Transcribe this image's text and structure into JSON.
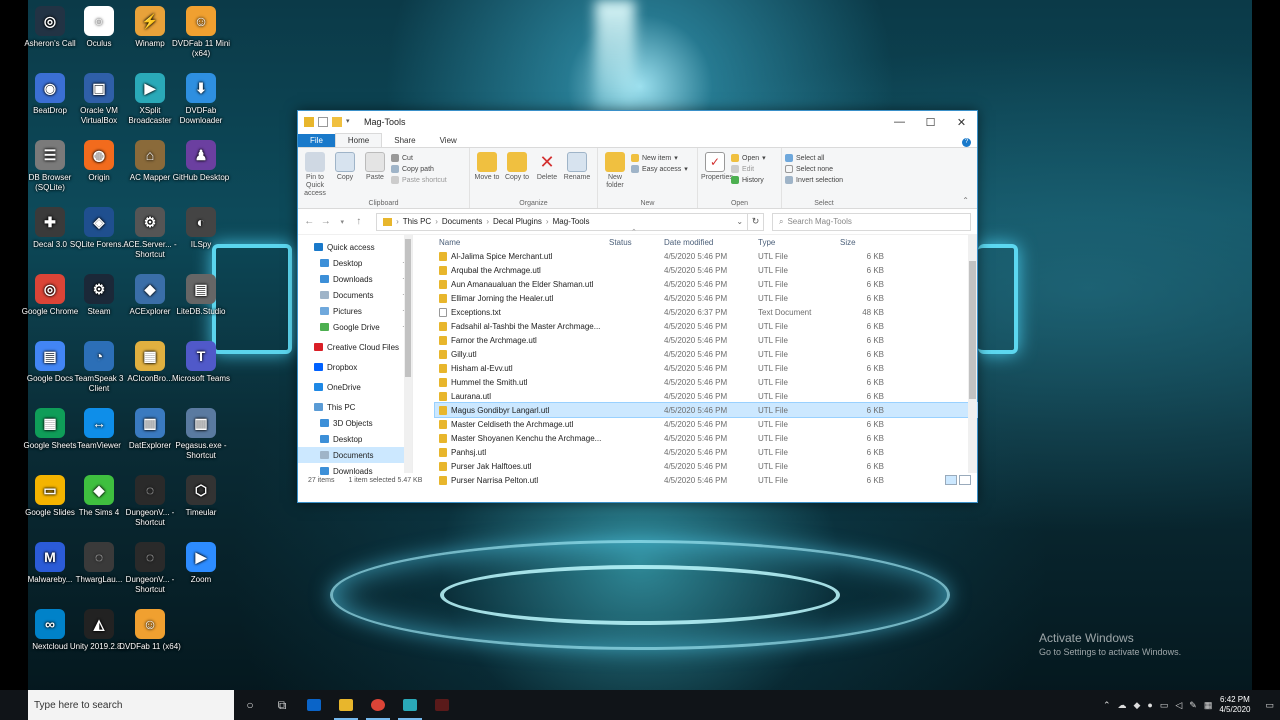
{
  "desktop_icons": [
    {
      "label": "Asheron's Call",
      "color": "#223344",
      "glyph": "◎"
    },
    {
      "label": "Oculus",
      "color": "#ffffff",
      "glyph": "○"
    },
    {
      "label": "Winamp",
      "color": "#e8a23a",
      "glyph": "⚡"
    },
    {
      "label": "DVDFab 11 Mini (x64)",
      "color": "#f0a030",
      "glyph": "☺"
    },
    {
      "label": "BeatDrop",
      "color": "#3b6fd4",
      "glyph": "◉"
    },
    {
      "label": "Oracle VM VirtualBox",
      "color": "#2f5fa8",
      "glyph": "▣"
    },
    {
      "label": "XSplit Broadcaster",
      "color": "#2aa9b8",
      "glyph": "▶"
    },
    {
      "label": "DVDFab Downloader",
      "color": "#2e8fe0",
      "glyph": "⬇"
    },
    {
      "label": "DB Browser (SQLite)",
      "color": "#7a7a7a",
      "glyph": "☰"
    },
    {
      "label": "Origin",
      "color": "#f26b1d",
      "glyph": "◍"
    },
    {
      "label": "AC Mapper",
      "color": "#8a6a3a",
      "glyph": "⌂"
    },
    {
      "label": "GitHub Desktop",
      "color": "#6b3fa0",
      "glyph": "♟"
    },
    {
      "label": "Decal 3.0",
      "color": "#3a3a3a",
      "glyph": "✚"
    },
    {
      "label": "SQLite Forens...",
      "color": "#1f4f8f",
      "glyph": "◈"
    },
    {
      "label": "ACE.Server... - Shortcut",
      "color": "#555555",
      "glyph": "⚙"
    },
    {
      "label": "ILSpy",
      "color": "#444444",
      "glyph": "◐"
    },
    {
      "label": "Google Chrome",
      "color": "#db4437",
      "glyph": "◎"
    },
    {
      "label": "Steam",
      "color": "#1b2838",
      "glyph": "⚙"
    },
    {
      "label": "ACExplorer",
      "color": "#3a6ea8",
      "glyph": "◆"
    },
    {
      "label": "LiteDB.Studio",
      "color": "#666666",
      "glyph": "▤"
    },
    {
      "label": "Google Docs",
      "color": "#4285f4",
      "glyph": "▤"
    },
    {
      "label": "TeamSpeak 3 Client",
      "color": "#2c6fb7",
      "glyph": "◔"
    },
    {
      "label": "ACIconBro...",
      "color": "#e0b040",
      "glyph": "▦"
    },
    {
      "label": "Microsoft Teams",
      "color": "#5059c9",
      "glyph": "T"
    },
    {
      "label": "Google Sheets",
      "color": "#0f9d58",
      "glyph": "▦"
    },
    {
      "label": "TeamViewer",
      "color": "#0e8ee9",
      "glyph": "↔"
    },
    {
      "label": "DatExplorer",
      "color": "#3a7ac0",
      "glyph": "▥"
    },
    {
      "label": "Pegasus.exe - Shortcut",
      "color": "#5a7aa0",
      "glyph": "▥"
    },
    {
      "label": "Google Slides",
      "color": "#f4b400",
      "glyph": "▭"
    },
    {
      "label": "The Sims 4",
      "color": "#3fbf3f",
      "glyph": "◆"
    },
    {
      "label": "DungeonV... - Shortcut",
      "color": "#2a2a2a",
      "glyph": "◌"
    },
    {
      "label": "Timeular",
      "color": "#333333",
      "glyph": "⬡"
    },
    {
      "label": "Malwareby...",
      "color": "#2b5bd7",
      "glyph": "M"
    },
    {
      "label": "ThwargLau...",
      "color": "#3a3a3a",
      "glyph": "◌"
    },
    {
      "label": "DungeonV... - Shortcut",
      "color": "#2a2a2a",
      "glyph": "◌"
    },
    {
      "label": "Zoom",
      "color": "#2d8cff",
      "glyph": "▶"
    },
    {
      "label": "Nextcloud",
      "color": "#0082c9",
      "glyph": "∞"
    },
    {
      "label": "Unity 2019.2.8...",
      "color": "#222222",
      "glyph": "◭"
    },
    {
      "label": "DVDFab 11 (x64)",
      "color": "#f0a030",
      "glyph": "☺"
    }
  ],
  "window": {
    "title": "Mag-Tools",
    "tabs": {
      "file": "File",
      "home": "Home",
      "share": "Share",
      "view": "View"
    },
    "ribbon": {
      "pin": "Pin to Quick access",
      "copy": "Copy",
      "paste": "Paste",
      "cut": "Cut",
      "copy_path": "Copy path",
      "paste_shortcut": "Paste shortcut",
      "clipboard": "Clipboard",
      "move_to": "Move to",
      "copy_to": "Copy to",
      "delete": "Delete",
      "rename": "Rename",
      "organize": "Organize",
      "new_folder": "New folder",
      "new_item": "New item",
      "easy_access": "Easy access",
      "new": "New",
      "properties": "Properties",
      "open": "Open",
      "edit": "Edit",
      "history": "History",
      "open_group": "Open",
      "select_all": "Select all",
      "select_none": "Select none",
      "invert_selection": "Invert selection",
      "select": "Select"
    },
    "breadcrumb": [
      "This PC",
      "Documents",
      "Decal Plugins",
      "Mag-Tools"
    ],
    "search_placeholder": "Search Mag-Tools",
    "nav": [
      {
        "label": "Quick access",
        "color": "#1979ca",
        "pin": false
      },
      {
        "label": "Desktop",
        "color": "#3c8fd8",
        "pin": true
      },
      {
        "label": "Downloads",
        "color": "#3c8fd8",
        "pin": true
      },
      {
        "label": "Documents",
        "color": "#9fb4c8",
        "pin": true
      },
      {
        "label": "Pictures",
        "color": "#6fa8dc",
        "pin": true
      },
      {
        "label": "Google Drive",
        "color": "#4caf50",
        "pin": true
      },
      {
        "label": "Creative Cloud Files",
        "color": "#da1f26",
        "pin": false
      },
      {
        "label": "Dropbox",
        "color": "#0061ff",
        "pin": false
      },
      {
        "label": "OneDrive",
        "color": "#1e88e5",
        "pin": false
      },
      {
        "label": "This PC",
        "color": "#5a9bd5",
        "pin": false
      },
      {
        "label": "3D Objects",
        "color": "#3c8fd8",
        "pin": false
      },
      {
        "label": "Desktop",
        "color": "#3c8fd8",
        "pin": false
      },
      {
        "label": "Documents",
        "color": "#9fb4c8",
        "pin": false
      },
      {
        "label": "Downloads",
        "color": "#3c8fd8",
        "pin": false
      }
    ],
    "columns": {
      "name": "Name",
      "status": "Status",
      "date": "Date modified",
      "type": "Type",
      "size": "Size"
    },
    "files": [
      {
        "name": "Al-Jalima Spice Merchant.utl",
        "date": "4/5/2020 5:46 PM",
        "type": "UTL File",
        "size": "6 KB"
      },
      {
        "name": "Arqubal the Archmage.utl",
        "date": "4/5/2020 5:46 PM",
        "type": "UTL File",
        "size": "6 KB"
      },
      {
        "name": "Aun Amanaualuan the Elder Shaman.utl",
        "date": "4/5/2020 5:46 PM",
        "type": "UTL File",
        "size": "6 KB"
      },
      {
        "name": "Ellimar Jorning the Healer.utl",
        "date": "4/5/2020 5:46 PM",
        "type": "UTL File",
        "size": "6 KB"
      },
      {
        "name": "Exceptions.txt",
        "date": "4/5/2020 6:37 PM",
        "type": "Text Document",
        "size": "48 KB"
      },
      {
        "name": "Fadsahil al-Tashbi the Master Archmage...",
        "date": "4/5/2020 5:46 PM",
        "type": "UTL File",
        "size": "6 KB"
      },
      {
        "name": "Farnor the Archmage.utl",
        "date": "4/5/2020 5:46 PM",
        "type": "UTL File",
        "size": "6 KB"
      },
      {
        "name": "Gilly.utl",
        "date": "4/5/2020 5:46 PM",
        "type": "UTL File",
        "size": "6 KB"
      },
      {
        "name": "Hisham al-Evv.utl",
        "date": "4/5/2020 5:46 PM",
        "type": "UTL File",
        "size": "6 KB"
      },
      {
        "name": "Hummel the Smith.utl",
        "date": "4/5/2020 5:46 PM",
        "type": "UTL File",
        "size": "6 KB"
      },
      {
        "name": "Laurana.utl",
        "date": "4/5/2020 5:46 PM",
        "type": "UTL File",
        "size": "6 KB"
      },
      {
        "name": "Magus Gondibyr Langarl.utl",
        "date": "4/5/2020 5:46 PM",
        "type": "UTL File",
        "size": "6 KB"
      },
      {
        "name": "Master Celdiseth the Archmage.utl",
        "date": "4/5/2020 5:46 PM",
        "type": "UTL File",
        "size": "6 KB"
      },
      {
        "name": "Master Shoyanen Kenchu the Archmage...",
        "date": "4/5/2020 5:46 PM",
        "type": "UTL File",
        "size": "6 KB"
      },
      {
        "name": "Panhsj.utl",
        "date": "4/5/2020 5:46 PM",
        "type": "UTL File",
        "size": "6 KB"
      },
      {
        "name": "Purser Jak Halftoes.utl",
        "date": "4/5/2020 5:46 PM",
        "type": "UTL File",
        "size": "6 KB"
      },
      {
        "name": "Purser Narrisa Pelton.utl",
        "date": "4/5/2020 5:46 PM",
        "type": "UTL File",
        "size": "6 KB"
      }
    ],
    "status": {
      "items": "27 items",
      "selected": "1 item selected  5.47 KB"
    }
  },
  "watermark": {
    "line1": "Activate Windows",
    "line2": "Go to Settings to activate Windows."
  },
  "taskbar": {
    "search_placeholder": "Type here to search",
    "time": "6:42 PM",
    "date": "4/5/2020"
  }
}
